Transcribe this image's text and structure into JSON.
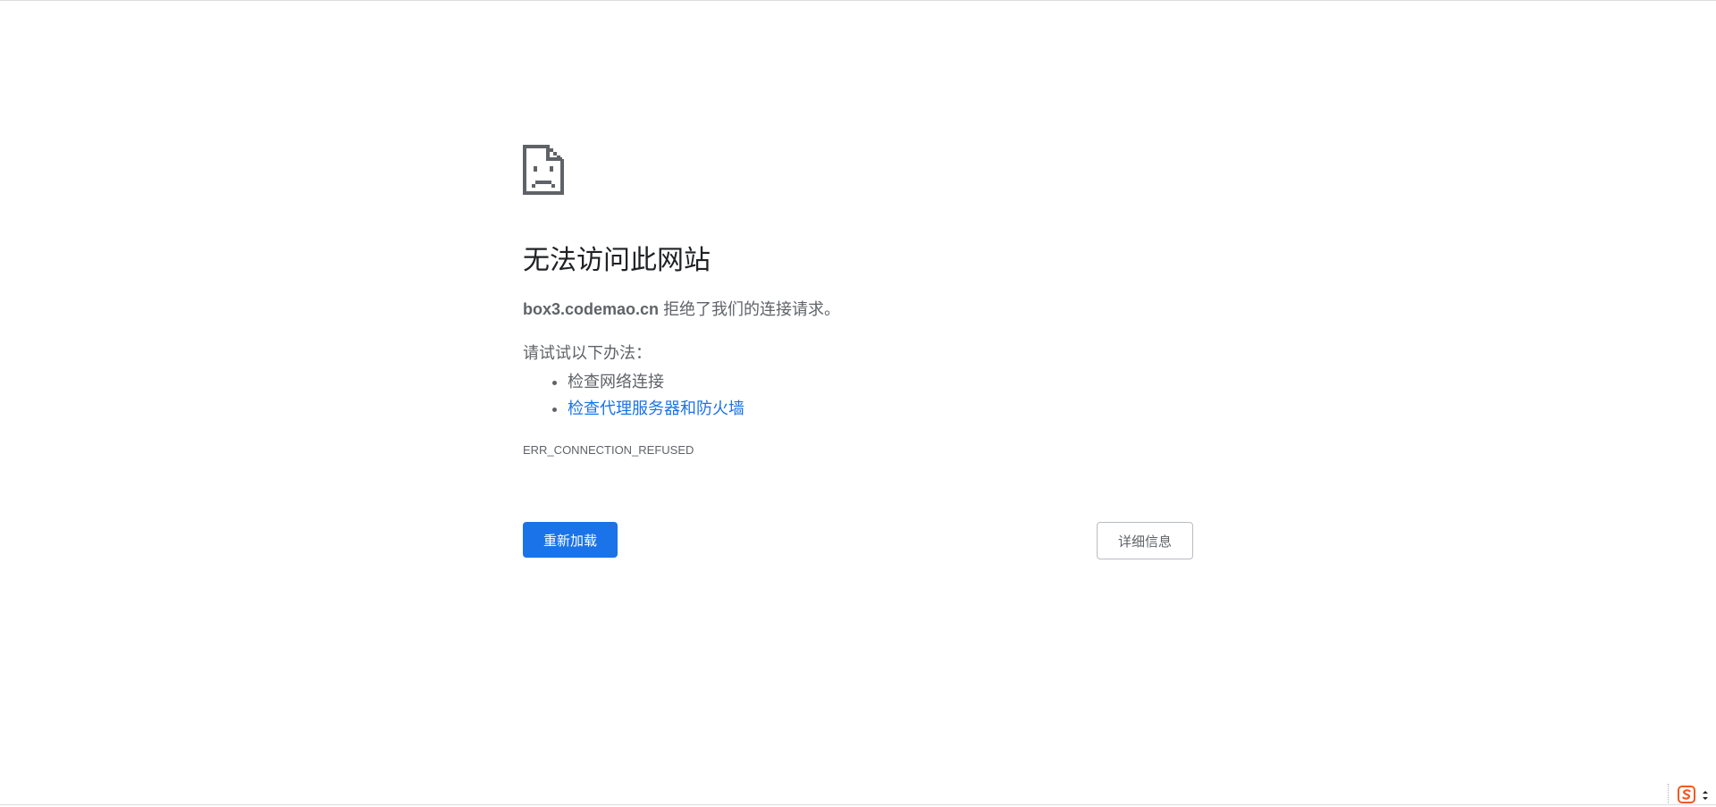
{
  "error_page": {
    "icon": "sad-page-icon",
    "title": "无法访问此网站",
    "host": "box3.codemao.cn",
    "summary_suffix": "拒绝了我们的连接请求。",
    "suggestions_intro": "请试试以下办法：",
    "suggestions": [
      {
        "label": "检查网络连接",
        "is_link": false
      },
      {
        "label": "检查代理服务器和防火墙",
        "is_link": true
      }
    ],
    "error_code": "ERR_CONNECTION_REFUSED",
    "reload_label": "重新加载",
    "details_label": "详细信息"
  },
  "tray": {
    "ime_icon": "sogou-ime-icon",
    "menu_icon": "tray-menu-arrows-icon"
  },
  "colors": {
    "accent": "#1a73e8",
    "title_text": "#202124",
    "body_text": "#5f6368",
    "ime_orange": "#f05a22"
  }
}
